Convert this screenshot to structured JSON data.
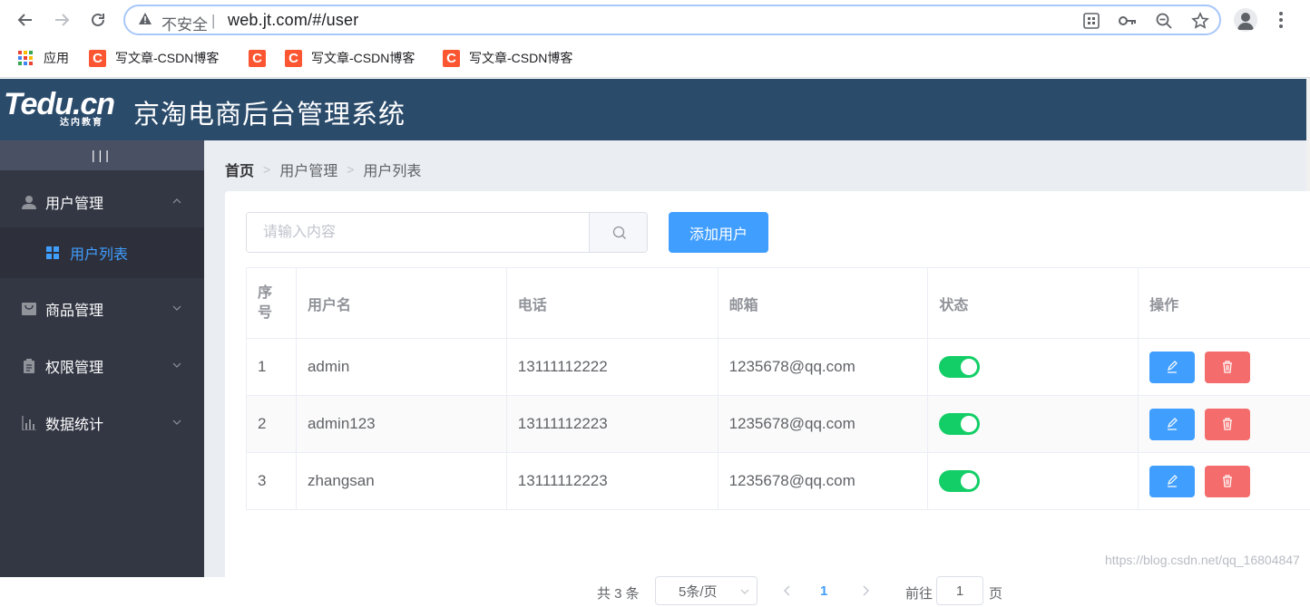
{
  "browser": {
    "security_label": "不安全",
    "separator": "|",
    "url": "web.jt.com/#/user",
    "bookmarks": [
      {
        "label": "应用"
      },
      {
        "label": "写文章-CSDN博客"
      },
      {
        "label": ""
      },
      {
        "label": "写文章-CSDN博客"
      },
      {
        "label": "写文章-CSDN博客"
      }
    ],
    "csdn_icon_letter": "C",
    "accent": "#fc5531"
  },
  "header": {
    "logo_text": "Tedu.cn",
    "logo_sub": "达内教育",
    "title": "京淘电商后台管理系统",
    "bg_color": "#2b4b6b"
  },
  "sidebar": {
    "toggle": "|||",
    "items": [
      {
        "label": "用户管理",
        "icon": "user-icon",
        "expanded": true
      },
      {
        "label": "商品管理",
        "icon": "goods-icon",
        "expanded": false
      },
      {
        "label": "权限管理",
        "icon": "permission-icon",
        "expanded": false
      },
      {
        "label": "数据统计",
        "icon": "chart-icon",
        "expanded": false
      }
    ],
    "subitem": {
      "label": "用户列表",
      "icon": "grid-icon"
    },
    "active_color": "#409eff"
  },
  "breadcrumb": {
    "home": "首页",
    "level1": "用户管理",
    "level2": "用户列表"
  },
  "toolbar": {
    "search_placeholder": "请输入内容",
    "add_label": "添加用户"
  },
  "table": {
    "headers": {
      "seq_top": "序",
      "seq_bottom": "号",
      "username": "用户名",
      "phone": "电话",
      "email": "邮箱",
      "status": "状态",
      "actions": "操作"
    },
    "rows": [
      {
        "seq": "1",
        "username": "admin",
        "phone": "13111112222",
        "email": "1235678@qq.com",
        "status": true
      },
      {
        "seq": "2",
        "username": "admin123",
        "phone": "13111112223",
        "email": "1235678@qq.com",
        "status": true
      },
      {
        "seq": "3",
        "username": "zhangsan",
        "phone": "13111112223",
        "email": "1235678@qq.com",
        "status": true
      }
    ]
  },
  "pagination": {
    "total_text": "共 3 条",
    "page_size": "5条/页",
    "current_page": "1",
    "goto_label": "前往",
    "goto_value": "1",
    "page_suffix": "页"
  },
  "watermark": "https://blog.csdn.net/qq_16804847"
}
